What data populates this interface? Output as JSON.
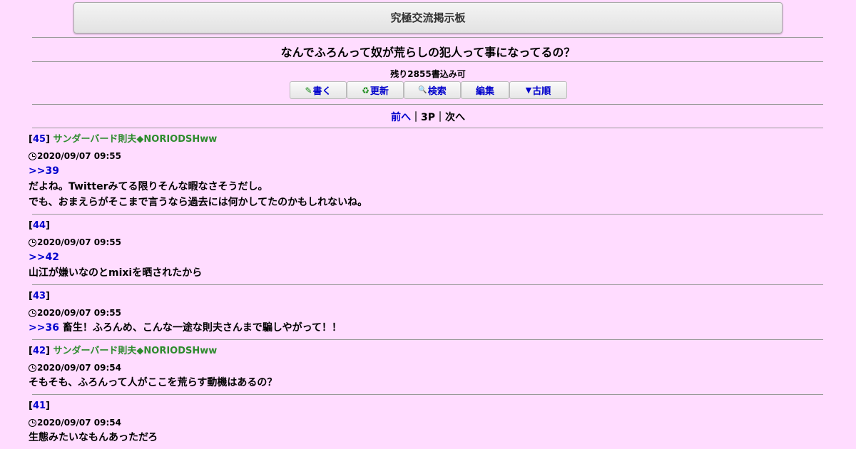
{
  "board": {
    "title": "究極交流掲示板"
  },
  "thread": {
    "title": "なんでふろんって奴が荒らしの犯人って事になってるの？",
    "remaining": "残り2855書込み可"
  },
  "toolbar": {
    "write": {
      "icon": "✎",
      "label": "書く"
    },
    "refresh": {
      "icon": "♻",
      "label": "更新"
    },
    "search": {
      "icon": "🔍",
      "label": "検索"
    },
    "edit": {
      "label": "編集"
    },
    "oldest": {
      "icon": "▼",
      "label": "古順"
    }
  },
  "pager": {
    "prev": "前へ",
    "sep1": "｜",
    "current": "3P",
    "sep2": "｜",
    "next": "次へ"
  },
  "posts": [
    {
      "number": "45",
      "name": "サンダーバード則夫◆NORIODSHww",
      "date": "2020/09/07 09:55",
      "anchor": ">>39",
      "lines": [
        "だよね。Twitterみてる限りそんな暇なさそうだし。",
        "でも、おまえらがそこまで言うなら過去には何かしてたのかもしれないね。"
      ]
    },
    {
      "number": "44",
      "name": "",
      "date": "2020/09/07 09:55",
      "anchor": ">>42",
      "lines": [
        "山江が嫌いなのとmixiを晒されたから"
      ]
    },
    {
      "number": "43",
      "name": "",
      "date": "2020/09/07 09:55",
      "anchor": ">>36",
      "inline": " 畜生！ふろんめ、こんな一途な則夫さんまで騙しやがって！！"
    },
    {
      "number": "42",
      "name": "サンダーバード則夫◆NORIODSHww",
      "date": "2020/09/07 09:54",
      "lines": [
        "そもそも、ふろんって人がここを荒らす動機はあるの？"
      ]
    },
    {
      "number": "41",
      "name": "",
      "date": "2020/09/07 09:54",
      "lines": [
        "生態みたいなもんあっただろ"
      ]
    }
  ]
}
